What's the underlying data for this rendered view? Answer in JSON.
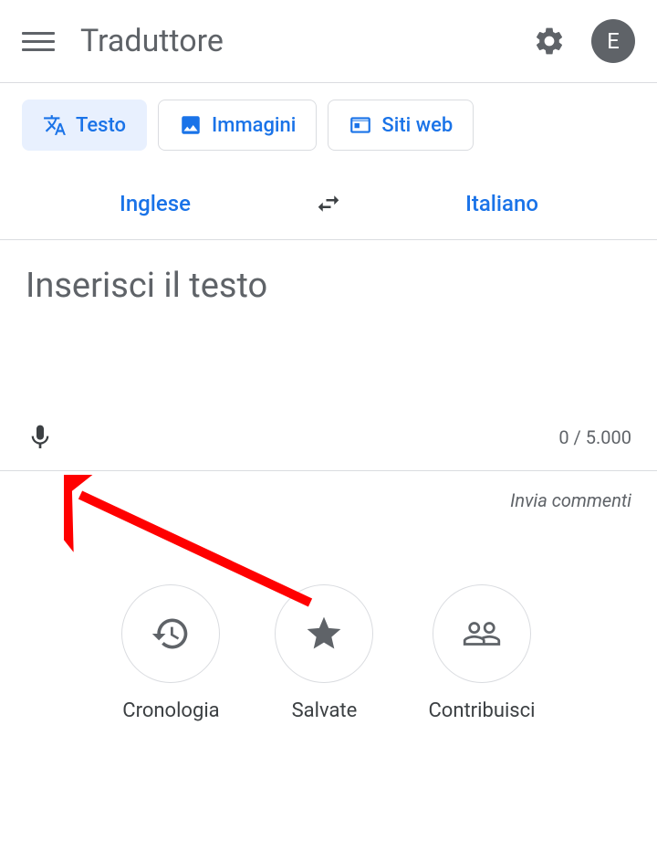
{
  "header": {
    "title": "Traduttore",
    "avatar_letter": "E"
  },
  "tabs": {
    "text": "Testo",
    "images": "Immagini",
    "websites": "Siti web"
  },
  "languages": {
    "source": "Inglese",
    "target": "Italiano"
  },
  "input": {
    "placeholder": "Inserisci il testo",
    "char_count": "0 / 5.000"
  },
  "feedback": {
    "label": "Invia commenti"
  },
  "actions": {
    "history": "Cronologia",
    "saved": "Salvate",
    "contribute": "Contribuisci"
  },
  "colors": {
    "primary": "#1a73e8",
    "grey": "#5f6368"
  }
}
